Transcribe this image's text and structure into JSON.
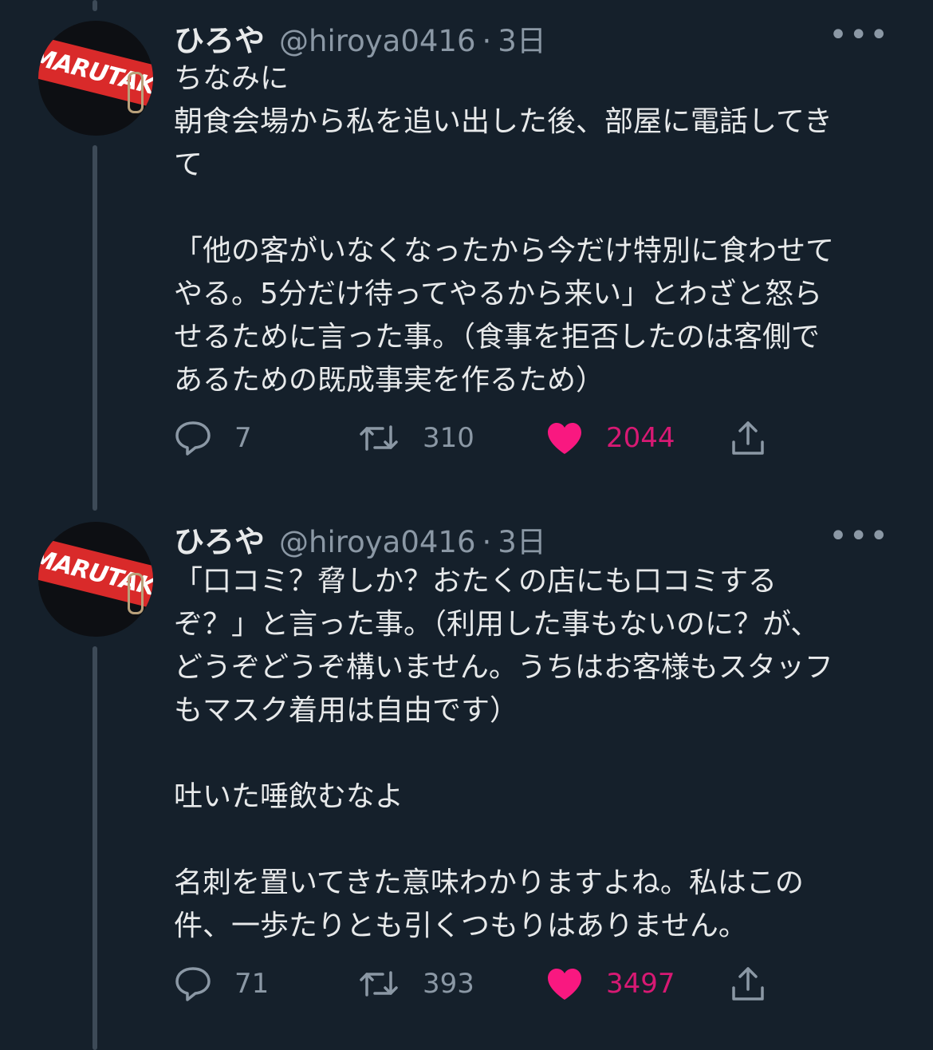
{
  "tweets": [
    {
      "author_name": "ひろや",
      "handle": "@hiroya0416",
      "separator": "·",
      "time": "3日",
      "more_label": "•••",
      "avatar_text": "MARUTAKA",
      "text": "ちなみに\n朝食会場から私を追い出した後、部屋に電話してき\nて\n\n「他の客がいなくなったから今だけ特別に食わせて\nやる。5分だけ待ってやるから来い」とわざと怒ら\nせるために言った事。（食事を拒否したのは客側で\nあるための既成事実を作るため）",
      "replies": "7",
      "retweets": "310",
      "likes": "2044"
    },
    {
      "author_name": "ひろや",
      "handle": "@hiroya0416",
      "separator": "·",
      "time": "3日",
      "more_label": "•••",
      "avatar_text": "MARUTAKA",
      "text": "「口コミ？脅しか？おたくの店にも口コミする\nぞ？」と言った事。（利用した事もないのに？が、\nどうぞどうぞ構いません。うちはお客様もスタッフ\nもマスク着用は自由です）\n\n吐いた唾飲むなよ\n\n名刺を置いてきた意味わかりますよね。私はこの\n件、一歩たりとも引くつもりはありません。",
      "replies": "71",
      "retweets": "393",
      "likes": "3497"
    }
  ],
  "colors": {
    "background": "#15202b",
    "text": "#e7e9ea",
    "secondary": "#8b98a5",
    "like": "#f91880",
    "thread_line": "#3d4a57"
  }
}
